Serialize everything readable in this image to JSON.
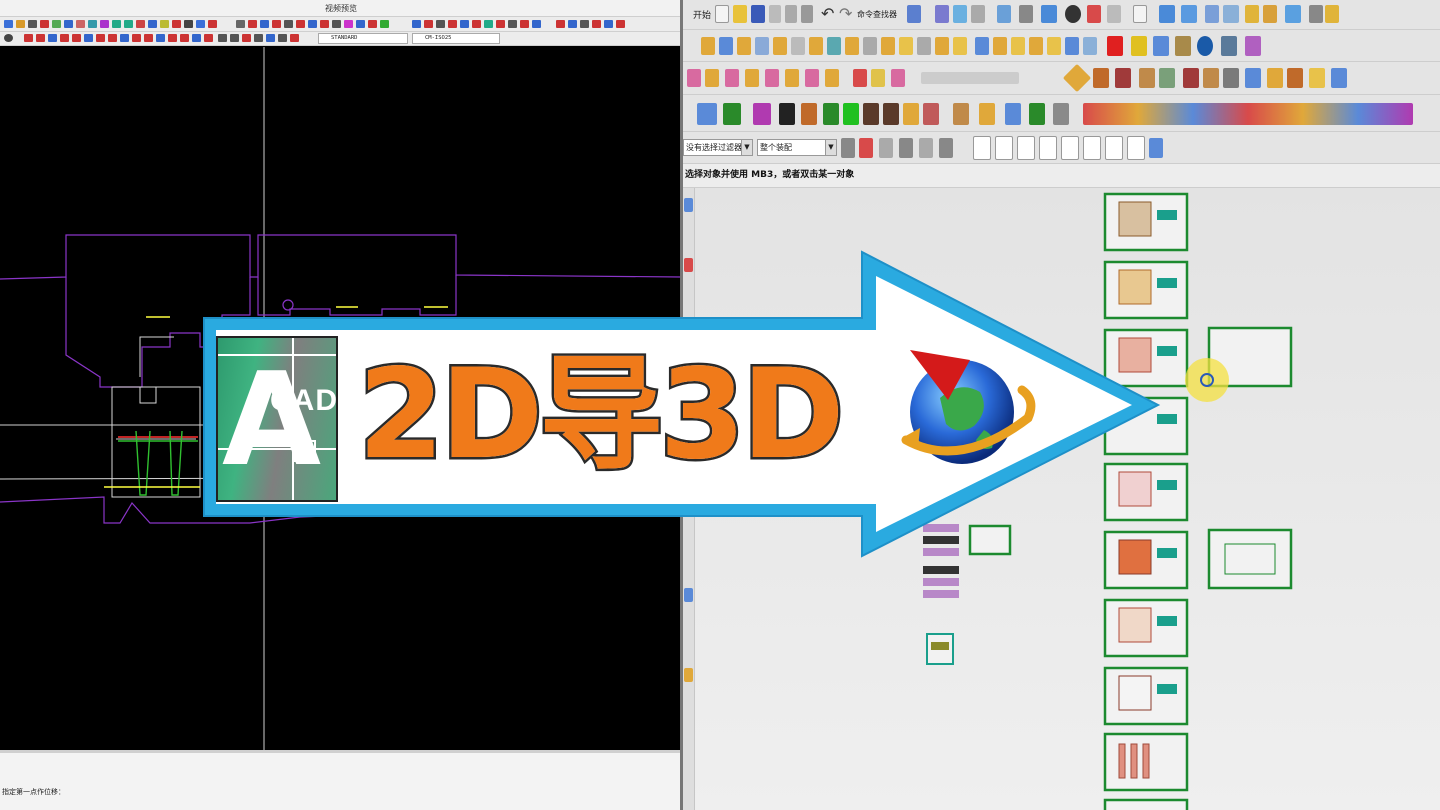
{
  "cad2d": {
    "window_title": "视频预览",
    "text_style_combo": "STANDARD",
    "dim_style_combo": "CM-ISO25",
    "command_prompt": "指定第一点作位移："
  },
  "cad3d": {
    "menu_start": "开始",
    "toolbar_labels": [
      "命令查找器"
    ],
    "filter_combo": "没有选择过滤器",
    "assembly_combo": "整个装配",
    "cue_line": "选择对象并使用 MB3，或者双击某一对象"
  },
  "banner": {
    "logo_big_letter": "A",
    "logo_text": "CAD",
    "headline": "2D导3D"
  },
  "colors": {
    "banner_fill": "#ffffff",
    "banner_border": "#2aaae0",
    "headline_orange": "#f07a1a",
    "canvas_black": "#000000",
    "part_green": "#1c8a2f",
    "part_teal": "#1a9f8c"
  }
}
